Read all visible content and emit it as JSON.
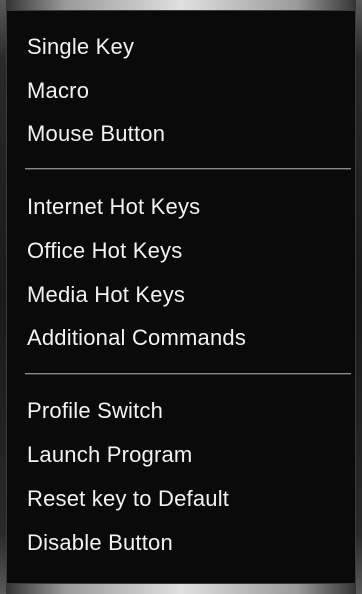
{
  "menu": {
    "groups": [
      {
        "items": [
          {
            "label": "Single Key"
          },
          {
            "label": "Macro"
          },
          {
            "label": "Mouse Button"
          }
        ]
      },
      {
        "items": [
          {
            "label": "Internet Hot Keys"
          },
          {
            "label": "Office Hot Keys"
          },
          {
            "label": "Media Hot Keys"
          },
          {
            "label": "Additional Commands"
          }
        ]
      },
      {
        "items": [
          {
            "label": "Profile Switch"
          },
          {
            "label": "Launch Program"
          },
          {
            "label": "Reset key to Default"
          },
          {
            "label": "Disable Button"
          }
        ]
      }
    ]
  }
}
